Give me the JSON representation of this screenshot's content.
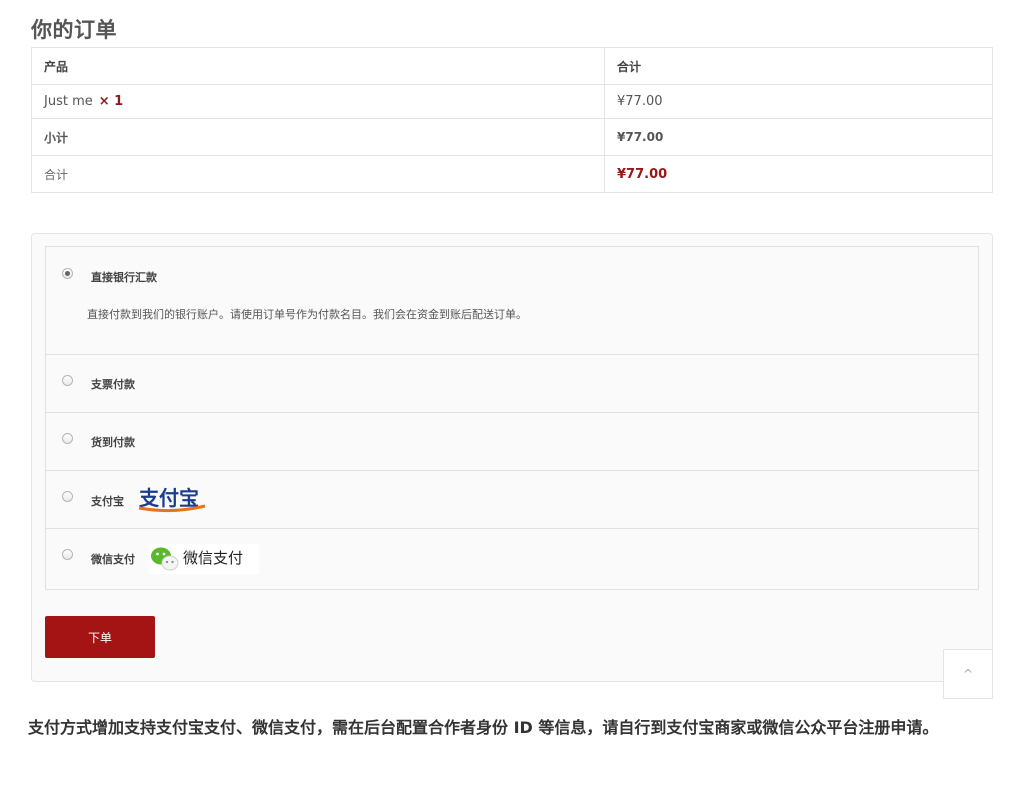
{
  "page_title": "你的订单",
  "table": {
    "header": {
      "product": "产品",
      "total": "合计"
    },
    "item": {
      "name": "Just me",
      "qty": "× 1",
      "price": "¥77.00"
    },
    "subtotal": {
      "label": "小计",
      "value": "¥77.00"
    },
    "total": {
      "label": "合计",
      "value": "¥77.00"
    }
  },
  "payment": {
    "methods": [
      {
        "label": "直接银行汇款",
        "selected": true,
        "description": "直接付款到我们的银行账户。请使用订单号作为付款名目。我们会在资金到账后配送订单。"
      },
      {
        "label": "支票付款",
        "selected": false
      },
      {
        "label": "货到付款",
        "selected": false
      },
      {
        "label": "支付宝",
        "selected": false,
        "logo": "支付宝"
      },
      {
        "label": "微信支付",
        "selected": false,
        "logo": "微信支付"
      }
    ],
    "place_order": "下单"
  },
  "scroll_top_icon": "^",
  "note": "支付方式增加支持支付宝支付、微信支付，需在后台配置合作者身份 ID 等信息，请自行到支付宝商家或微信公众平台注册申请。",
  "colors": {
    "accent": "#a51414",
    "price_red": "#9b1515",
    "alipay_blue": "#1a3d8f",
    "wechat_green": "#5ab82a"
  }
}
